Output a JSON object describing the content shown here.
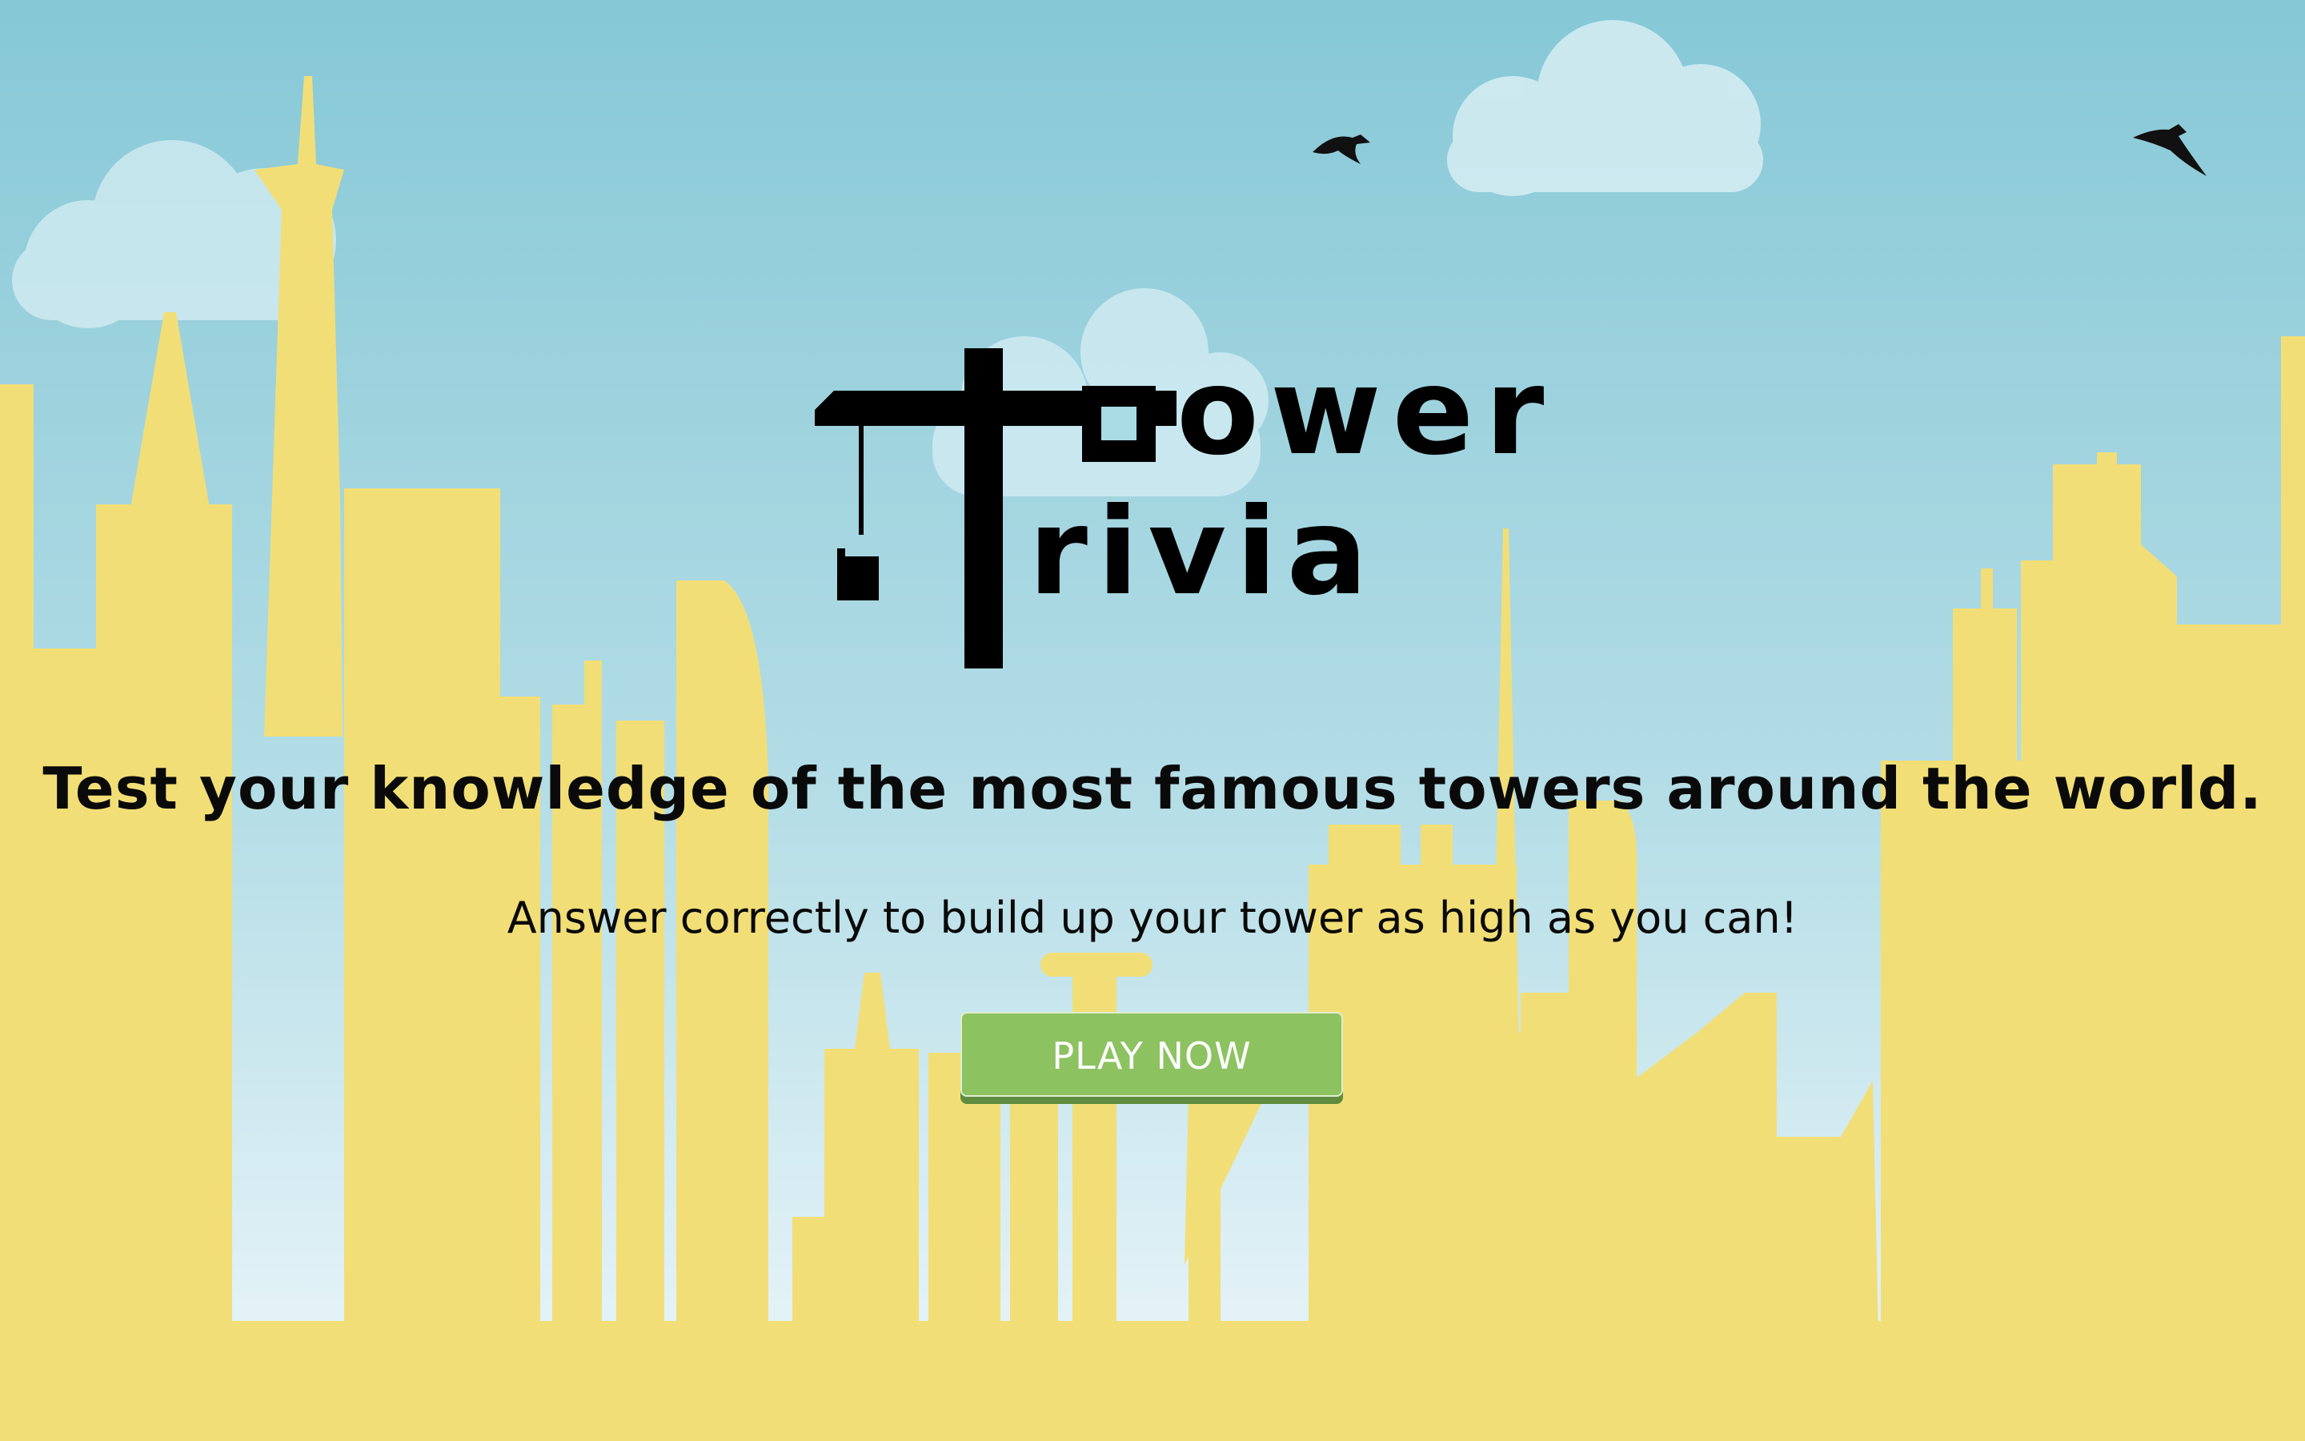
{
  "game": {
    "logo": {
      "word_1": "ower",
      "word_2": "rivia"
    },
    "headline": "Test your knowledge of the most famous towers around the world.",
    "subline": "Answer correctly to build up your tower as high as you can!",
    "play_button_label": "PLAY NOW"
  },
  "colors": {
    "sky_top": "#86c8d6",
    "sky_bottom": "#eef7fb",
    "buildings": "#f2de77",
    "cloud": "#d7eef4",
    "logo": "#000000",
    "button": "#8cc260",
    "button_shadow": "#5f8c3e",
    "text": "#0a0a0a"
  },
  "icons": {
    "logo_crane": "crane-icon",
    "bird_1": "bird-icon",
    "bird_2": "bird-icon"
  }
}
